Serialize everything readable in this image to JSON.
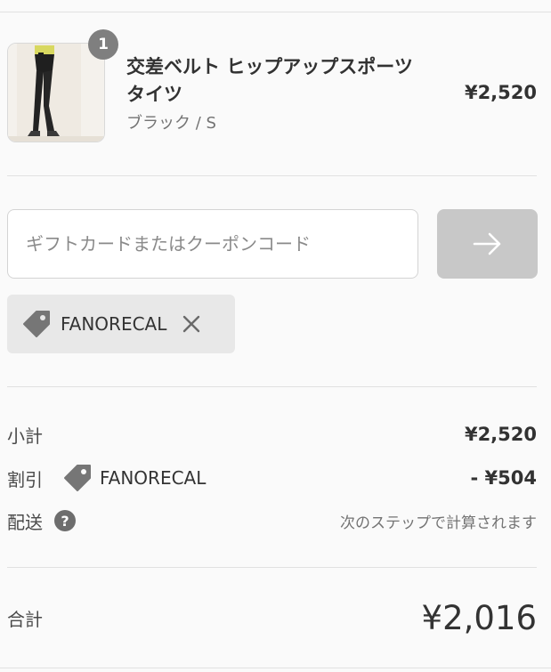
{
  "product": {
    "quantity": "1",
    "name": "交差ベルト ヒップアップスポーツタイツ",
    "variant": "ブラック / S",
    "price": "¥2,520"
  },
  "coupon": {
    "placeholder": "ギフトカードまたはクーポンコード",
    "value": "",
    "apply_icon": "arrow-right-icon",
    "applied_code": "FANORECAL"
  },
  "summary": {
    "subtotal_label": "小計",
    "subtotal_value": "¥2,520",
    "discount_label": "割引",
    "discount_code": "FANORECAL",
    "discount_value": "- ¥504",
    "shipping_label": "配送",
    "shipping_note": "次のステップで計算されます",
    "total_label": "合計",
    "total_value": "¥2,016"
  },
  "colors": {
    "background": "#fafafa",
    "badge": "#7f7f7f",
    "apply_button": "#c8c8c8",
    "chip": "#e8e8e8"
  }
}
